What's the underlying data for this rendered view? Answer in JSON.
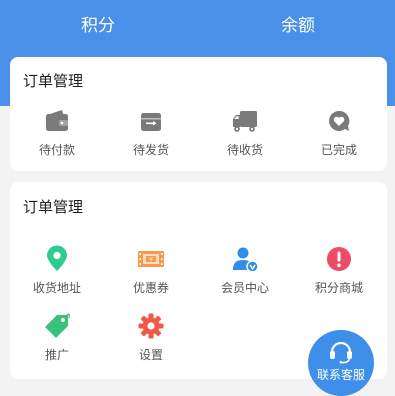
{
  "header": {
    "tabs": [
      {
        "label": "积分"
      },
      {
        "label": "余额"
      }
    ]
  },
  "orders": {
    "title": "订单管理",
    "items": [
      {
        "label": "待付款",
        "icon": "wallet-icon"
      },
      {
        "label": "待发货",
        "icon": "delivery-box-icon"
      },
      {
        "label": "待收货",
        "icon": "truck-icon"
      },
      {
        "label": "已完成",
        "icon": "chat-heart-icon"
      }
    ]
  },
  "services": {
    "title": "订单管理",
    "items": [
      {
        "label": "收货地址",
        "icon": "location-pin-icon",
        "color": "#2ecc8f"
      },
      {
        "label": "优惠券",
        "icon": "coupon-icon",
        "color": "#f59a4e"
      },
      {
        "label": "会员中心",
        "icon": "member-user-icon",
        "color": "#2f8fe8"
      },
      {
        "label": "积分商城",
        "icon": "exclamation-icon",
        "color": "#ee4b67"
      },
      {
        "label": "推广",
        "icon": "tag-icon",
        "color": "#39c27a"
      },
      {
        "label": "设置",
        "icon": "gear-icon",
        "color": "#f05a45"
      }
    ]
  },
  "support": {
    "label": "联系客服",
    "icon": "headset-icon"
  },
  "colors": {
    "header_bg": "#4a90e8",
    "icon_gray": "#7a7a7a",
    "fab_bg": "#3d8fe9"
  }
}
